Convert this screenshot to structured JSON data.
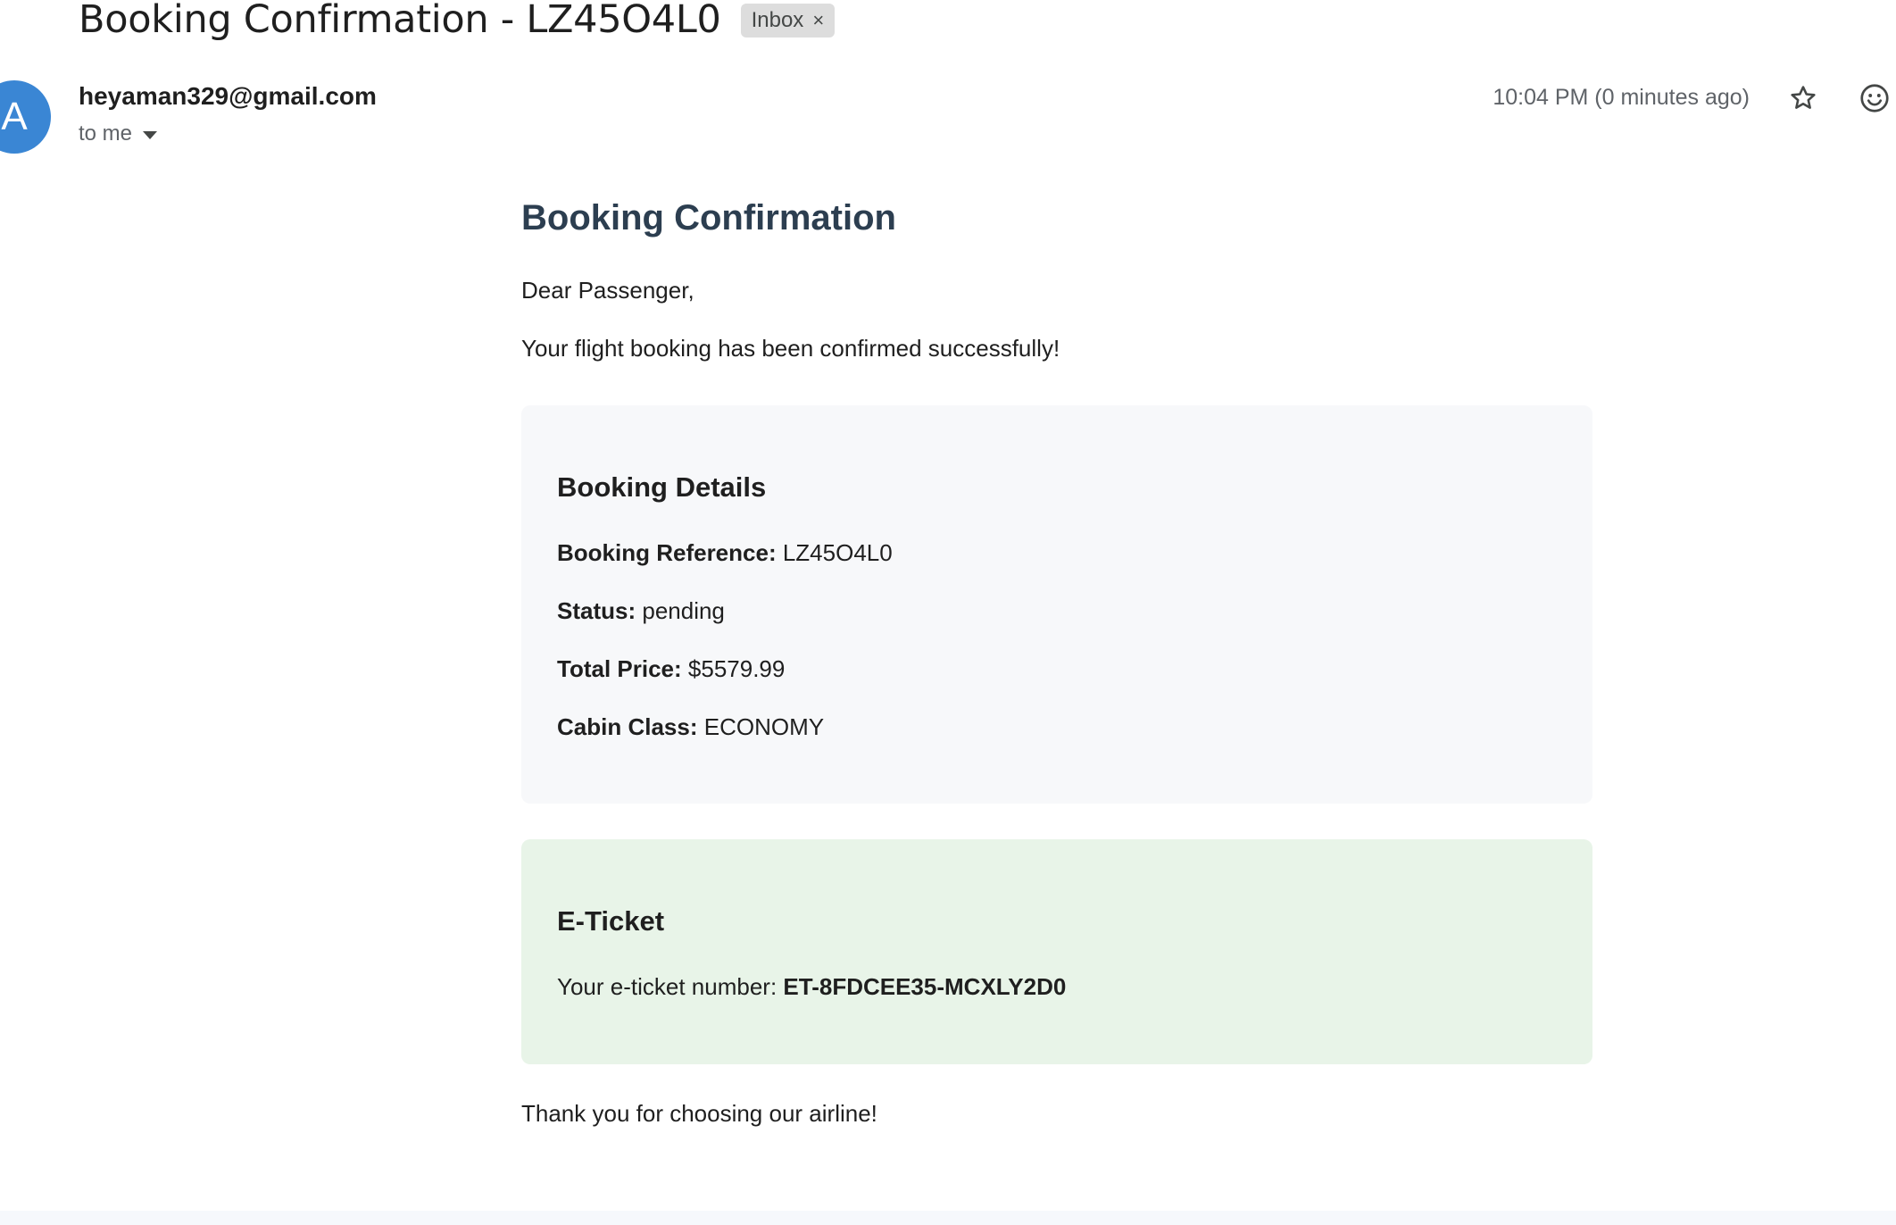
{
  "email": {
    "subject": "Booking Confirmation - LZ45O4L0",
    "label": "Inbox",
    "label_remove": "×",
    "avatar_letter": "A",
    "sender": "heyaman329@gmail.com",
    "recipient": "to me",
    "timestamp": "10:04 PM (0 minutes ago)"
  },
  "content": {
    "heading": "Booking Confirmation",
    "greeting": "Dear Passenger,",
    "intro": "Your flight booking has been confirmed successfully!",
    "details": {
      "title": "Booking Details",
      "reference_label": "Booking Reference:",
      "reference_value": "LZ45O4L0",
      "status_label": "Status:",
      "status_value": "pending",
      "price_label": "Total Price:",
      "price_value": "$5579.99",
      "cabin_label": "Cabin Class:",
      "cabin_value": "ECONOMY"
    },
    "ticket": {
      "title": "E-Ticket",
      "number_label": "Your e-ticket number:",
      "number_value": "ET-8FDCEE35-MCXLY2D0"
    },
    "closing": "Thank you for choosing our airline!"
  },
  "colors": {
    "avatar": "#3a86d4",
    "heading": "#2c3e50",
    "details_bg": "#f7f8fa",
    "ticket_bg": "#e8f4e8"
  },
  "icons": [
    "star-icon",
    "emoji-reaction-icon",
    "chevron-down-icon",
    "close-icon"
  ]
}
